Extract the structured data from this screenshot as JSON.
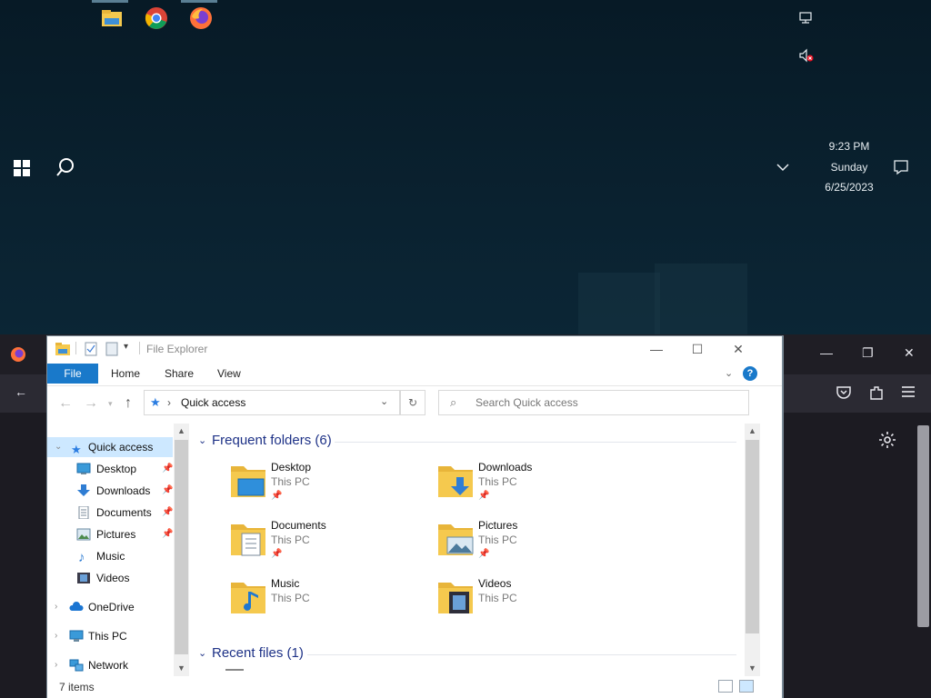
{
  "desktop": {
    "icons": [
      "file-explorer-icon",
      "chrome-icon",
      "firefox-icon"
    ],
    "clock": {
      "time": "9:23 PM",
      "day": "Sunday",
      "date": "6/25/2023"
    }
  },
  "explorer": {
    "title": "File Explorer",
    "ribbon": {
      "file": "File",
      "tabs": [
        "Home",
        "Share",
        "View"
      ],
      "help": "?"
    },
    "address": {
      "location": "Quick access",
      "separator": "›"
    },
    "search": {
      "placeholder": "Search Quick access"
    },
    "nav": [
      {
        "label": "Quick access",
        "icon": "star-icon"
      },
      {
        "label": "Desktop",
        "icon": "desktop-folder-icon"
      },
      {
        "label": "Downloads",
        "icon": "download-arrow-icon"
      },
      {
        "label": "Documents",
        "icon": "documents-icon"
      },
      {
        "label": "Pictures",
        "icon": "pictures-icon"
      },
      {
        "label": "Music",
        "icon": "music-note-icon"
      },
      {
        "label": "Videos",
        "icon": "videos-icon"
      },
      {
        "label": "OneDrive",
        "icon": "cloud-icon"
      },
      {
        "label": "This PC",
        "icon": "computer-icon"
      },
      {
        "label": "Network",
        "icon": "network-icon"
      }
    ],
    "groups": {
      "frequent": "Frequent folders (6)",
      "recent": "Recent files (1)"
    },
    "folders": [
      {
        "name": "Desktop",
        "sub": "This PC",
        "pinned": true
      },
      {
        "name": "Downloads",
        "sub": "This PC",
        "pinned": true
      },
      {
        "name": "Documents",
        "sub": "This PC",
        "pinned": true
      },
      {
        "name": "Pictures",
        "sub": "This PC",
        "pinned": true
      },
      {
        "name": "Music",
        "sub": "This PC",
        "pinned": false
      },
      {
        "name": "Videos",
        "sub": "This PC",
        "pinned": false
      }
    ],
    "status": "7 items"
  },
  "colors": {
    "accent": "#1979ca",
    "selection": "#cde8ff",
    "groupHeader": "#1e3287",
    "folderYellow": "#f5c94e"
  }
}
